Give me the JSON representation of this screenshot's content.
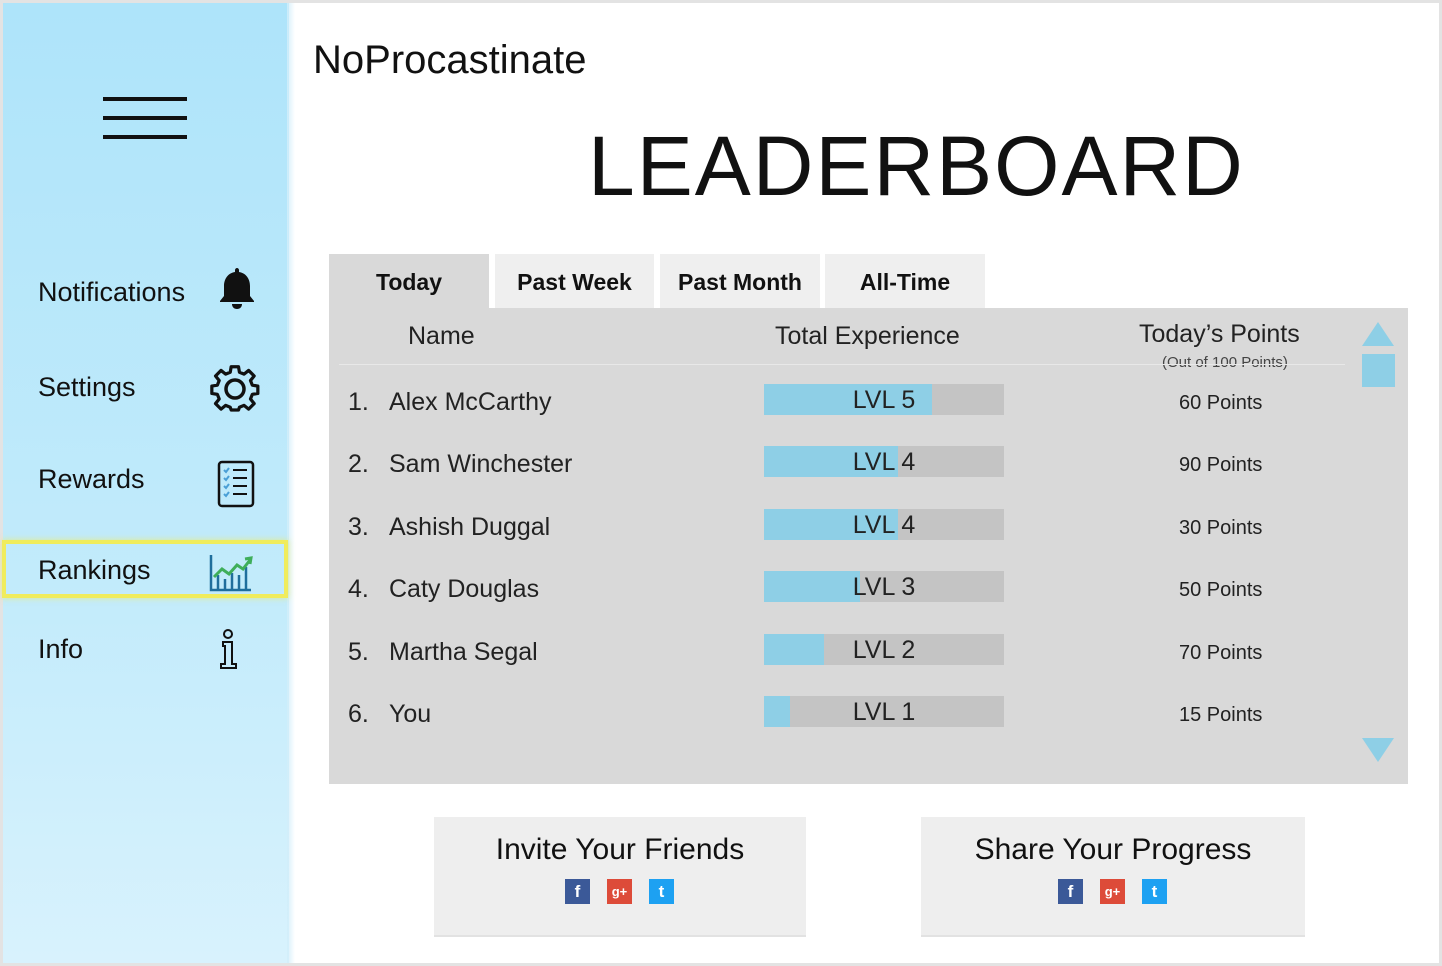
{
  "app": {
    "title": "NoProcastinate"
  },
  "page": {
    "title": "LEADERBOARD"
  },
  "sidebar": {
    "items": [
      {
        "label": "Notifications",
        "icon": "bell-icon"
      },
      {
        "label": "Settings",
        "icon": "gear-icon"
      },
      {
        "label": "Rewards",
        "icon": "checklist-icon"
      },
      {
        "label": "Rankings",
        "icon": "chart-icon",
        "active": true
      },
      {
        "label": "Info",
        "icon": "info-icon"
      }
    ]
  },
  "tabs": [
    {
      "label": "Today",
      "active": true
    },
    {
      "label": "Past Week"
    },
    {
      "label": "Past Month"
    },
    {
      "label": "All-Time"
    }
  ],
  "table": {
    "headers": {
      "name": "Name",
      "experience": "Total Experience",
      "points": "Today’s Points",
      "points_sub": "(Out of 100 Points)"
    },
    "rows": [
      {
        "rank": "1.",
        "name": "Alex McCarthy",
        "level": "LVL 5",
        "progress": 0.7,
        "points": "60 Points"
      },
      {
        "rank": "2.",
        "name": "Sam Winchester",
        "level": "LVL 4",
        "progress": 0.56,
        "points": "90 Points"
      },
      {
        "rank": "3.",
        "name": "Ashish Duggal",
        "level": "LVL 4",
        "progress": 0.56,
        "points": "30 Points"
      },
      {
        "rank": "4.",
        "name": "Caty Douglas",
        "level": "LVL 3",
        "progress": 0.4,
        "points": "50 Points"
      },
      {
        "rank": "5.",
        "name": "Martha Segal",
        "level": "LVL 2",
        "progress": 0.25,
        "points": "70 Points"
      },
      {
        "rank": "6.",
        "name": "You",
        "level": "LVL 1",
        "progress": 0.11,
        "points": "15 Points"
      }
    ]
  },
  "actions": {
    "invite": "Invite Your Friends",
    "share": "Share Your Progress"
  },
  "colors": {
    "sidebar": "#aee4fa",
    "accent": "#8ecfe6",
    "highlight": "#f0ec5c",
    "panel": "#d9d9d9"
  }
}
